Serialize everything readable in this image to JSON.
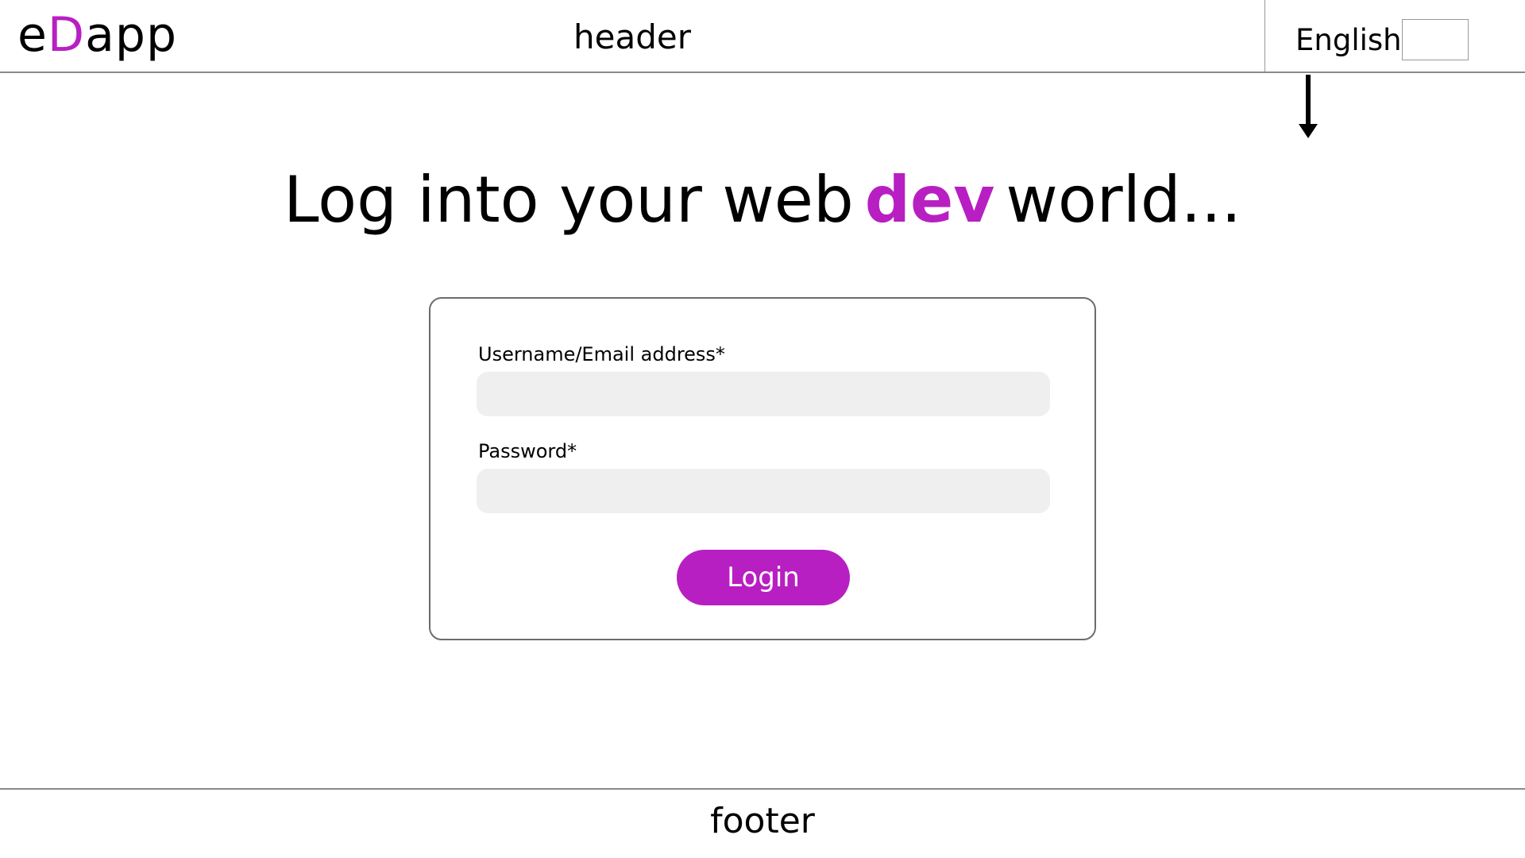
{
  "header": {
    "logo_prefix": "e",
    "logo_accent": "D",
    "logo_suffix": "app",
    "title": "header",
    "language_label": "English",
    "language_select_value": ""
  },
  "hero": {
    "text_before": "Log into your web",
    "text_accent": "dev",
    "text_after": "world..."
  },
  "login_form": {
    "username_label": "Username/Email address*",
    "username_value": "",
    "password_label": "Password*",
    "password_value": "",
    "login_button_label": "Login"
  },
  "footer": {
    "text": "footer"
  },
  "colors": {
    "accent": "#b81fc2",
    "input_background": "#efefef",
    "border": "#8a8a8a"
  }
}
